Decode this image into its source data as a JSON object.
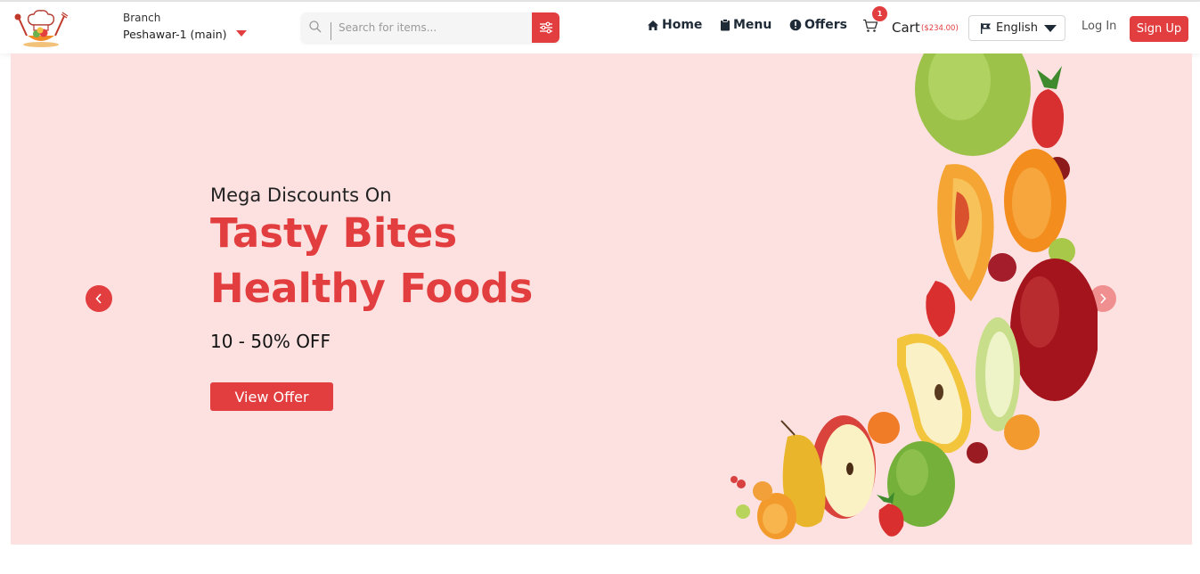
{
  "header": {
    "branch": {
      "label": "Branch",
      "value": "Peshawar-1 (main)"
    },
    "search": {
      "placeholder": "Search for items..."
    },
    "nav": {
      "home": "Home",
      "menu": "Menu",
      "offers": "Offers"
    },
    "cart": {
      "label": "Cart",
      "total": "($234.00)",
      "count": "1"
    },
    "language": {
      "selected": "English"
    },
    "login_label": "Log In",
    "signup_label": "Sign Up"
  },
  "hero": {
    "subtitle": "Mega Discounts On",
    "title_line1": "Tasty Bites",
    "title_line2": "Healthy Foods",
    "discount": "10 - 50% OFF",
    "cta_label": "View Offer"
  },
  "colors": {
    "accent": "#e23d3f",
    "hero_background": "#fde1e1",
    "nav_text": "#1f2a37"
  },
  "icons": [
    "logo-chef-icon",
    "search-icon",
    "filter-icon",
    "home-icon",
    "menu-clipboard-icon",
    "offers-icon",
    "cart-icon",
    "flag-icon",
    "chevron-left-icon",
    "chevron-right-icon"
  ]
}
